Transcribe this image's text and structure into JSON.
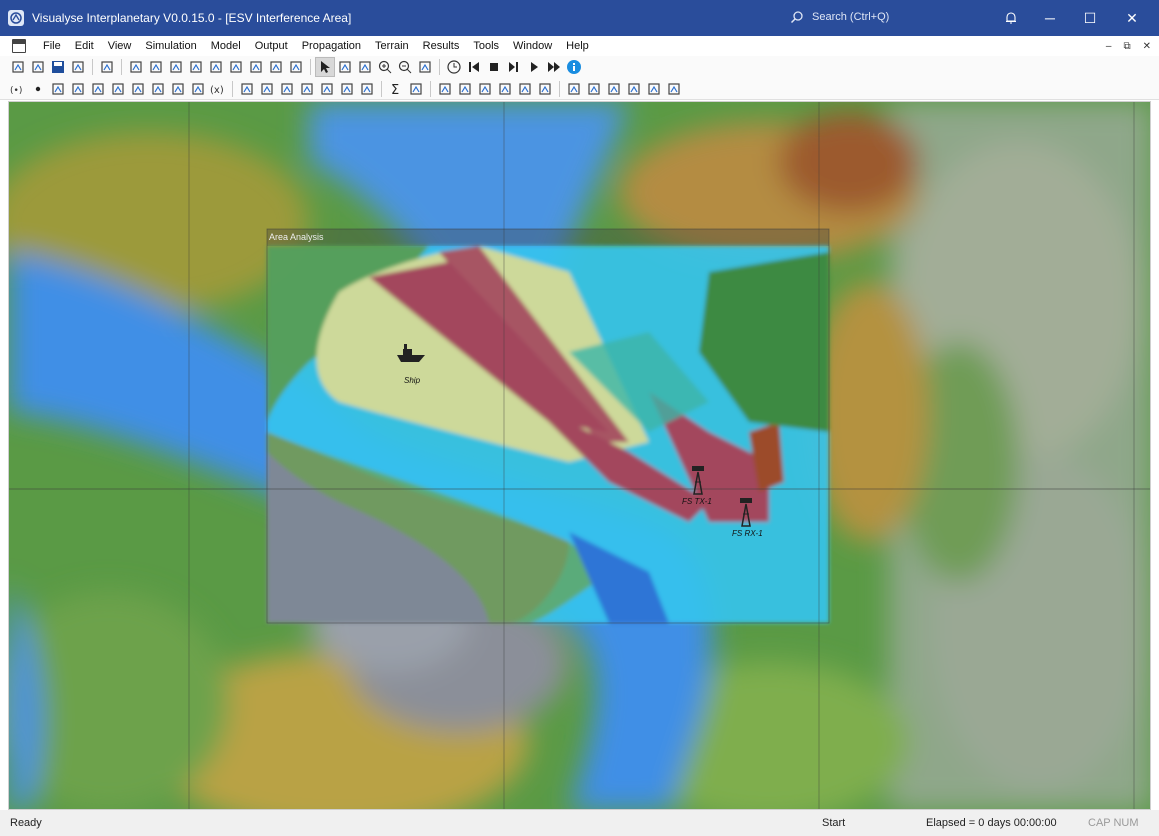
{
  "window": {
    "title": "Visualyse Interplanetary V0.0.15.0 - [ESV Interference Area]",
    "search_placeholder": "Search (Ctrl+Q)",
    "controls": {
      "notify": "bell-icon",
      "minimize": "─",
      "maximize": "☐",
      "close": "✕"
    },
    "accent": "#2a4d9b"
  },
  "menu": {
    "items": [
      "File",
      "Edit",
      "View",
      "Simulation",
      "Model",
      "Output",
      "Propagation",
      "Terrain",
      "Results",
      "Tools",
      "Window",
      "Help"
    ],
    "mdi_controls": [
      "–",
      "⧉",
      "✕"
    ]
  },
  "toolbar1": {
    "groups": [
      [
        "new-icon",
        "open-icon",
        "save-icon",
        "save-as-icon"
      ],
      [
        "copy-icon"
      ],
      [
        "view-world-icon",
        "view-map-icon",
        "view-3d-icon",
        "view-terrain-icon",
        "view-fov-icon",
        "view-area-icon",
        "view-table-icon",
        "view-watch-icon",
        "view-satellite-icon"
      ],
      [
        "select-icon",
        "select-station-icon",
        "select-area-icon",
        "zoom-in-icon",
        "zoom-out-icon",
        "zoom-fit-icon"
      ],
      [
        "clock-icon",
        "rewind-icon",
        "stop-icon",
        "step-icon",
        "play-icon",
        "fast-forward-icon",
        "info-icon"
      ]
    ]
  },
  "toolbar2": {
    "groups": [
      [
        "antenna-icon",
        "point-icon",
        "constellation-icon",
        "link-icon",
        "line-icon",
        "grid-icon",
        "arrow-icon",
        "route-icon",
        "updown-icon",
        "group-icon",
        "variable-icon"
      ],
      [
        "station-icon",
        "carrier-icon",
        "station-group-icon",
        "interference-icon",
        "signal-icon",
        "coverage-icon",
        "link-budget-icon"
      ],
      [
        "sigma-icon",
        "report-icon"
      ],
      [
        "watch-icon",
        "area-analysis-icon",
        "add-area-icon",
        "chart-icon",
        "histogram-icon",
        "bar-chart-icon"
      ],
      [
        "terrain-icon",
        "terrain-area-icon",
        "terrain-path-icon",
        "terrain-profile-icon",
        "terrain-export-icon",
        "terrain-settings-icon"
      ]
    ]
  },
  "map": {
    "area_label": "Area Analysis",
    "markers": [
      {
        "label": "Ship",
        "icon": "ship-icon"
      },
      {
        "label": "FS TX-1",
        "icon": "tower-icon"
      },
      {
        "label": "FS RX-1",
        "icon": "tower-icon"
      }
    ],
    "colors": {
      "sea": "#3f8fe6",
      "land_green": "#4f9b3a",
      "terrain_yellow": "#c6a43a",
      "interference_red": "#a3465d",
      "level_cyan": "#35c4ee",
      "level_pale": "#cdd99a"
    }
  },
  "status": {
    "ready": "Ready",
    "start": "Start",
    "elapsed": "Elapsed = 0 days 00:00:00",
    "caps": "CAP NUM"
  }
}
